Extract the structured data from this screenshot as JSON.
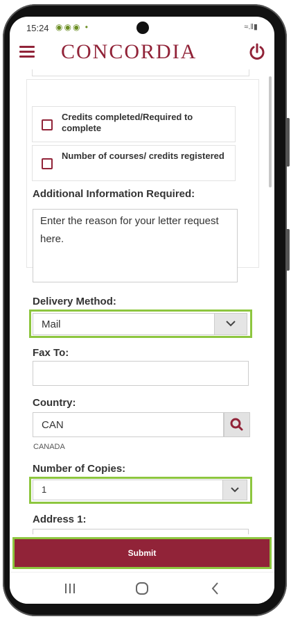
{
  "status": {
    "time": "15:24",
    "notification_icons": [
      "android-icon",
      "android-icon",
      "android-icon",
      "dot-icon"
    ],
    "system_icons": [
      "wifi-icon",
      "signal-icon",
      "battery-icon"
    ]
  },
  "header": {
    "brand": "CONCORDIA",
    "menu_icon": "hamburger-icon",
    "power_icon": "power-icon",
    "brand_color": "#912338"
  },
  "checkboxes": [
    {
      "label": "Credits completed/Required to complete",
      "checked": false
    },
    {
      "label": "Number of courses/ credits registered",
      "checked": false
    }
  ],
  "additional_info": {
    "label": "Additional Information Required:",
    "placeholder": "Enter the reason for your letter request here."
  },
  "delivery": {
    "label": "Delivery Method:",
    "selected": "Mail"
  },
  "fax": {
    "label": "Fax To:",
    "value": ""
  },
  "country": {
    "label": "Country:",
    "value": "CAN",
    "full_name": "CANADA"
  },
  "copies": {
    "label": "Number of Copies:",
    "selected": "1"
  },
  "address1": {
    "label": "Address 1:",
    "value": ""
  },
  "submit": {
    "label": "Submit"
  },
  "navbar": [
    "recent-apps-icon",
    "home-icon",
    "back-icon"
  ],
  "colors": {
    "accent": "#912338",
    "highlight": "#8dc63f"
  }
}
